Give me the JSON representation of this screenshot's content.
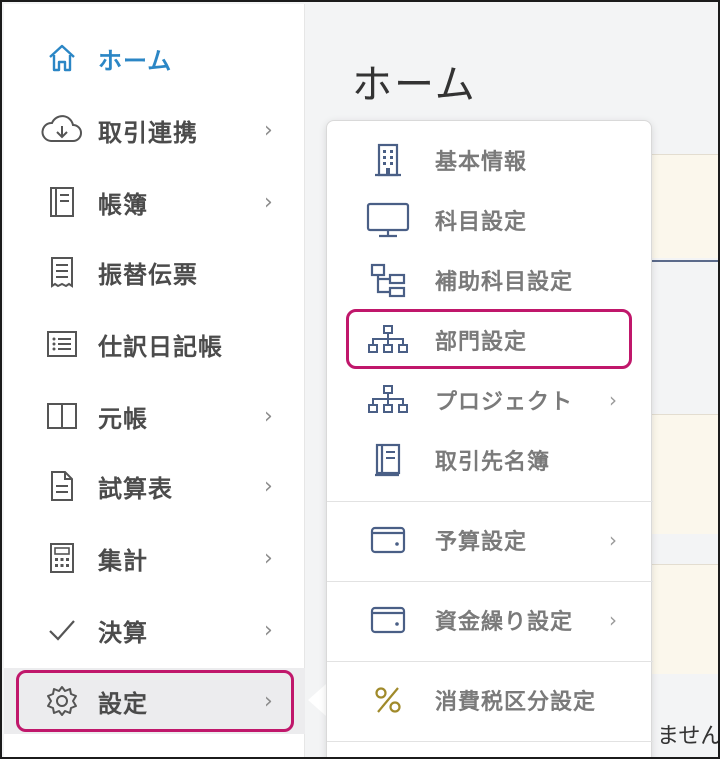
{
  "sidebar": {
    "items": [
      {
        "label": "ホーム",
        "icon": "home-icon",
        "chevron": ""
      },
      {
        "label": "取引連携",
        "icon": "cloud-download-icon",
        "chevron": "›"
      },
      {
        "label": "帳簿",
        "icon": "book-icon",
        "chevron": "›"
      },
      {
        "label": "振替伝票",
        "icon": "receipt-icon",
        "chevron": ""
      },
      {
        "label": "仕訳日記帳",
        "icon": "list-icon",
        "chevron": ""
      },
      {
        "label": "元帳",
        "icon": "ledger-icon",
        "chevron": "›"
      },
      {
        "label": "試算表",
        "icon": "document-icon",
        "chevron": "›"
      },
      {
        "label": "集計",
        "icon": "calculator-icon",
        "chevron": "›"
      },
      {
        "label": "決算",
        "icon": "checkmark-icon",
        "chevron": "›"
      },
      {
        "label": "設定",
        "icon": "gear-icon",
        "chevron": "›"
      }
    ]
  },
  "main": {
    "title": "ホーム",
    "bottom_text": "ません"
  },
  "settings_menu": {
    "items": [
      {
        "label": "基本情報",
        "icon": "building-icon",
        "chevron": ""
      },
      {
        "label": "科目設定",
        "icon": "monitor-icon",
        "chevron": ""
      },
      {
        "label": "補助科目設定",
        "icon": "sub-hierarchy-icon",
        "chevron": ""
      },
      {
        "label": "部門設定",
        "icon": "org-chart-icon",
        "chevron": ""
      },
      {
        "label": "プロジェクト",
        "icon": "org-chart-icon",
        "chevron": "›"
      },
      {
        "label": "取引先名簿",
        "icon": "address-book-icon",
        "chevron": ""
      },
      {
        "label": "予算設定",
        "icon": "wallet-icon",
        "chevron": "›"
      },
      {
        "label": "資金繰り設定",
        "icon": "wallet-icon",
        "chevron": "›"
      },
      {
        "label": "消費税区分設定",
        "icon": "percent-icon",
        "chevron": ""
      }
    ]
  },
  "colors": {
    "accent": "#2b86c5",
    "highlight": "#c0176b",
    "icon_blue": "#4a5f86",
    "percent_gold": "#a08a2a"
  }
}
